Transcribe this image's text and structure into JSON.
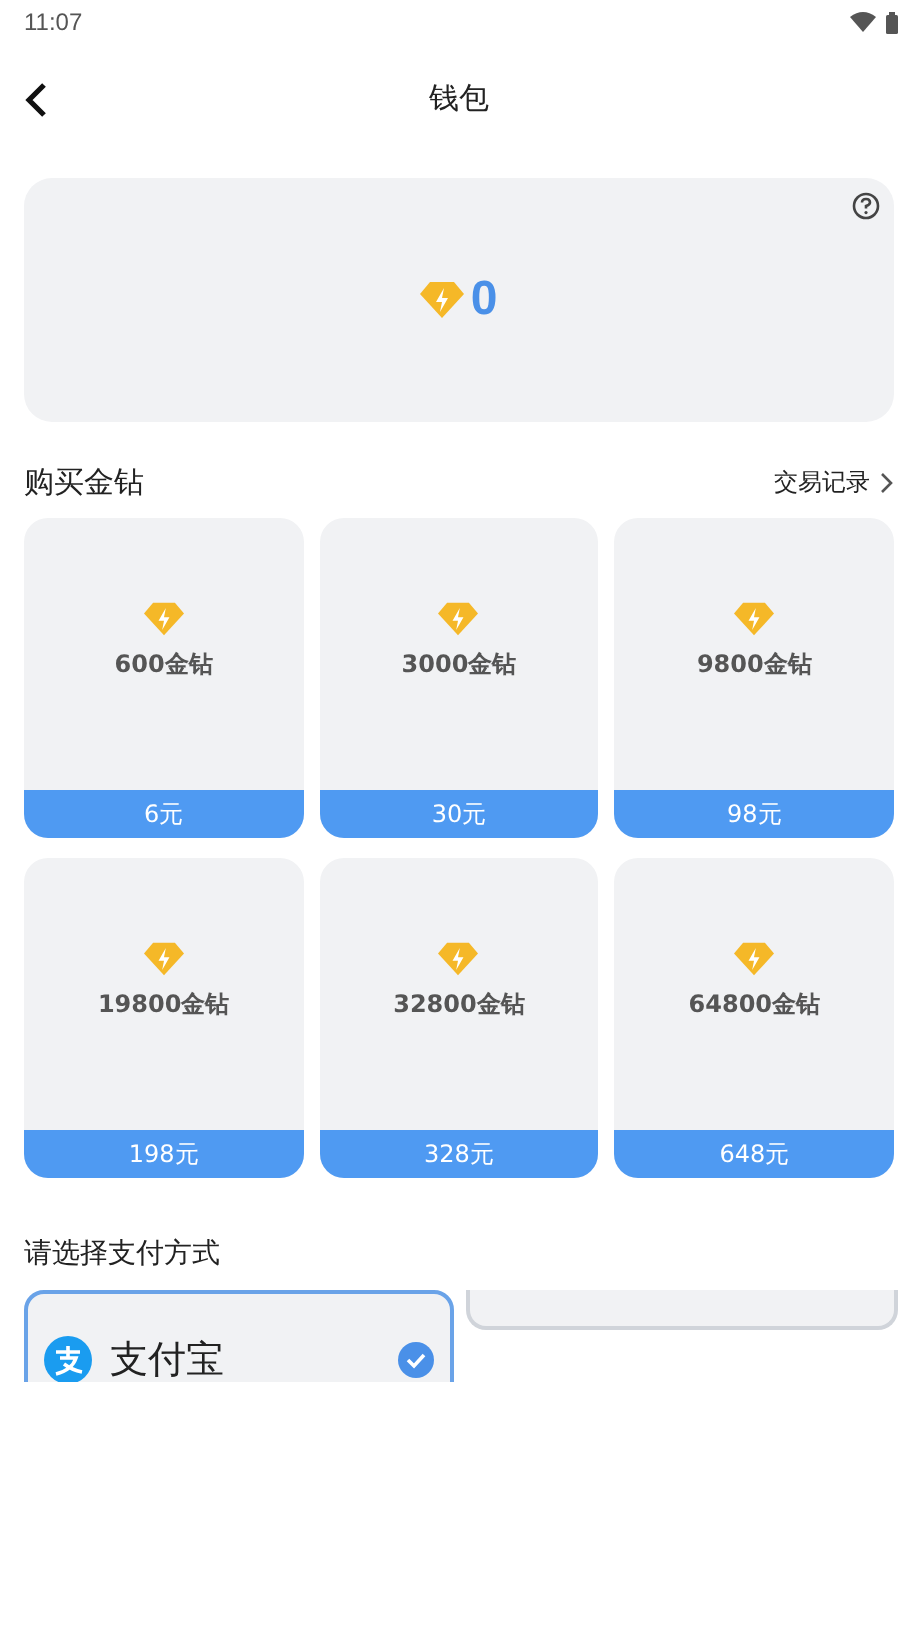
{
  "status_bar": {
    "time": "11:07"
  },
  "header": {
    "title": "钱包"
  },
  "balance": {
    "amount": "0"
  },
  "purchase": {
    "title": "购买金钻",
    "history_link": "交易记录",
    "packages": [
      {
        "amount": "600金钻",
        "price": "6元"
      },
      {
        "amount": "3000金钻",
        "price": "30元"
      },
      {
        "amount": "9800金钻",
        "price": "98元"
      },
      {
        "amount": "19800金钻",
        "price": "198元"
      },
      {
        "amount": "32800金钻",
        "price": "328元"
      },
      {
        "amount": "64800金钻",
        "price": "648元"
      }
    ]
  },
  "payment": {
    "title": "请选择支付方式",
    "methods": [
      {
        "kind": "alipay",
        "label": "支付宝",
        "selected": true
      },
      {
        "kind": "hidden",
        "selected": false
      }
    ]
  }
}
